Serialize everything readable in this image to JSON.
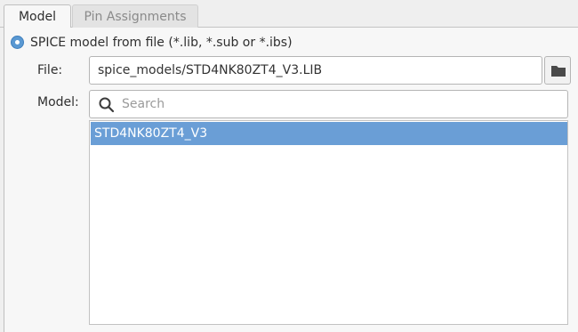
{
  "tabs": [
    {
      "label": "Model"
    },
    {
      "label": "Pin Assignments"
    }
  ],
  "source": {
    "radio_label": "SPICE model from file (*.lib, *.sub or *.ibs)",
    "file_label": "File:",
    "file_value": "spice_models/STD4NK80ZT4_V3.LIB",
    "model_label": "Model:",
    "search_placeholder": "Search",
    "models": [
      "STD4NK80ZT4_V3"
    ]
  },
  "colors": {
    "accent": "#5a98d2",
    "selection": "#6a9ed6"
  },
  "icons": {
    "folder": "folder-icon",
    "search": "search-icon"
  }
}
